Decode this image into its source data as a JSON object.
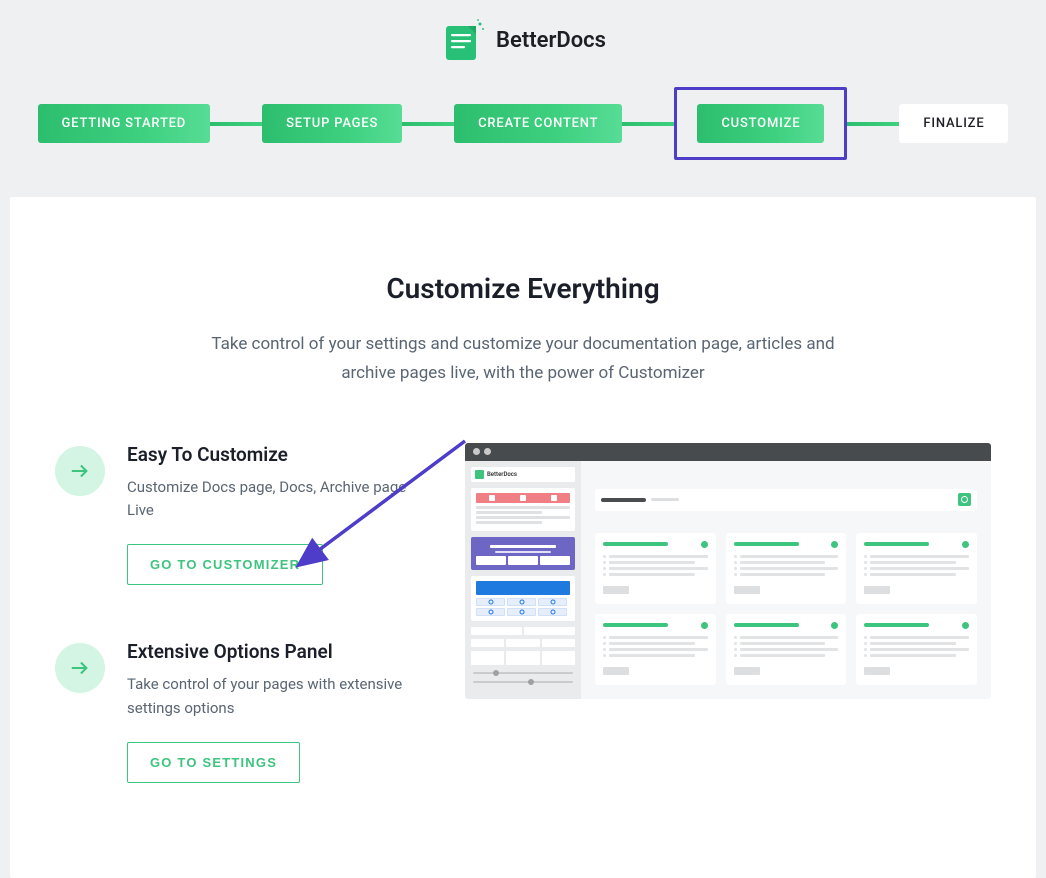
{
  "brand": {
    "name": "BetterDocs"
  },
  "steps": [
    {
      "label": "GETTING STARTED",
      "active": true
    },
    {
      "label": "SETUP PAGES",
      "active": true
    },
    {
      "label": "CREATE CONTENT",
      "active": true
    },
    {
      "label": "CUSTOMIZE",
      "active": true,
      "highlighted": true
    },
    {
      "label": "FINALIZE",
      "active": false
    }
  ],
  "page": {
    "title": "Customize Everything",
    "subtitle": "Take control of your settings and customize your documentation page, articles and archive pages live, with the power of Customizer"
  },
  "features": [
    {
      "title": "Easy To Customize",
      "desc": "Customize Docs page, Docs, Archive page Live",
      "button": "GO TO CUSTOMIZER"
    },
    {
      "title": "Extensive Options Panel",
      "desc": "Take control of your pages with extensive settings options",
      "button": "GO TO SETTINGS"
    }
  ],
  "preview": {
    "sidebar_logo": "BetterDocs"
  }
}
